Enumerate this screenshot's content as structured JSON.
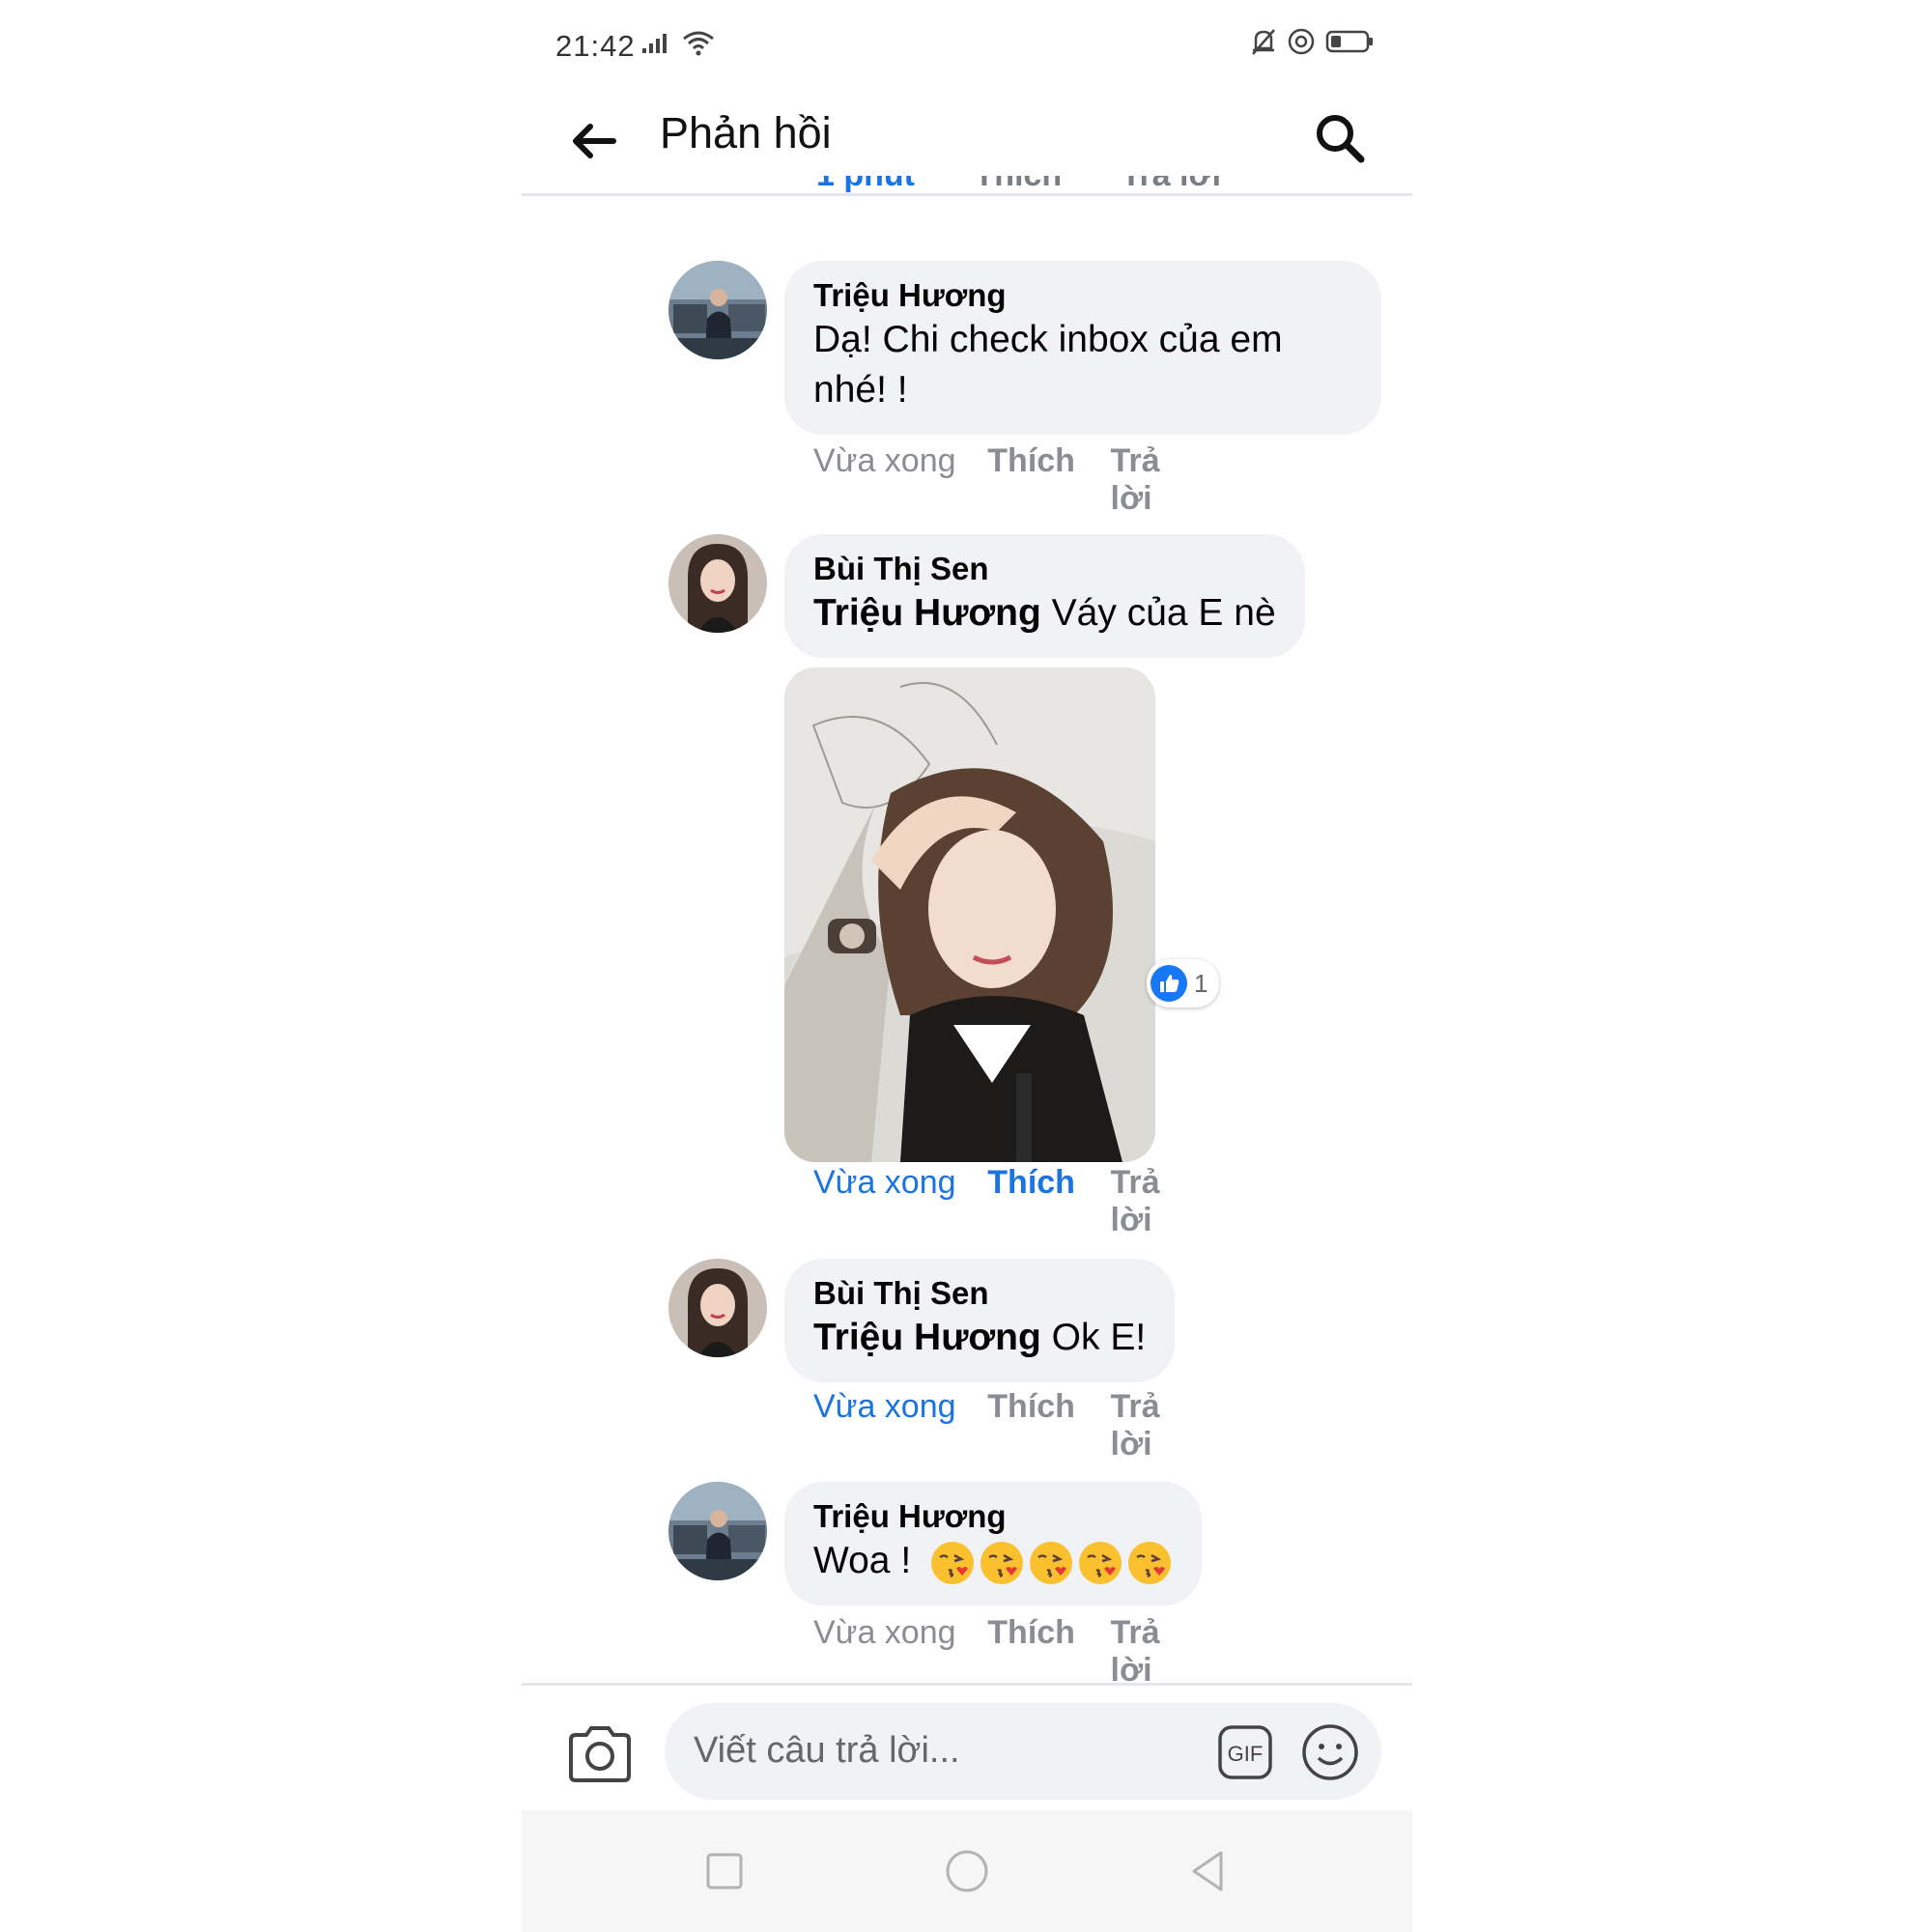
{
  "status_bar": {
    "time": "21:42"
  },
  "header": {
    "title": "Phản hồi"
  },
  "clipped_actions": [
    "1 phút",
    "Thích",
    "Trả lời"
  ],
  "comments": [
    {
      "author": "Triệu Hương",
      "text": "Dạ! Chi check inbox của em nhé! !",
      "time": "Vừa xong",
      "like": "Thích",
      "reply": "Trả lời"
    },
    {
      "author": "Bùi Thị Sen",
      "mention": "Triệu Hương",
      "text": "Váy của E nè",
      "time": "Vừa xong",
      "like": "Thích",
      "reply": "Trả lời",
      "reaction_count": "1"
    },
    {
      "author": "Bùi Thị Sen",
      "mention": "Triệu Hương",
      "text": "Ok E!",
      "time": "Vừa xong",
      "like": "Thích",
      "reply": "Trả lời"
    },
    {
      "author": "Triệu Hương",
      "text": "Woa !",
      "emojis": [
        "kissing-heart",
        "kissing-heart",
        "kissing-heart",
        "kissing-heart",
        "kissing-heart"
      ],
      "time": "Vừa xong",
      "like": "Thích",
      "reply": "Trả lời"
    }
  ],
  "composer": {
    "placeholder": "Viết câu trả lời...",
    "gif_label": "GIF"
  },
  "colors": {
    "accent": "#1b74e4",
    "bubble": "#f0f2f5",
    "muted": "#8a8d91"
  },
  "icons": [
    "back-arrow-icon",
    "search-icon",
    "camera-icon",
    "gif-icon",
    "emoji-icon",
    "recent-apps-icon",
    "home-icon",
    "back-nav-icon",
    "like-icon"
  ]
}
